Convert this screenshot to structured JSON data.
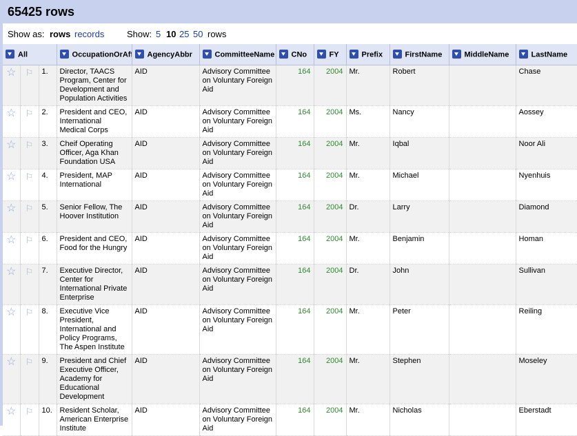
{
  "header": {
    "title": "65425 rows"
  },
  "controls": {
    "show_as_label": "Show as:",
    "view_rows": "rows",
    "view_records": "records",
    "show_label": "Show:",
    "page_sizes": [
      "5",
      "10",
      "25",
      "50"
    ],
    "rows_suffix": "rows"
  },
  "columns": [
    "All",
    "OccupationOrAffiliation",
    "AgencyAbbr",
    "CommitteeName",
    "CNo",
    "FY",
    "Prefix",
    "FirstName",
    "MiddleName",
    "LastName"
  ],
  "icons": {
    "star": "star-icon",
    "flag": "flag-icon",
    "dropdown": "dropdown-arrow-icon"
  },
  "colors": {
    "header_bg": "#c8d2ee",
    "link": "#1c3fa8",
    "number": "#2e8b2e",
    "dropdown": "#2f4fae"
  },
  "rows": [
    {
      "index": "1.",
      "occupation": "Director, TAACS Program, Center for Development and Population Activities",
      "agency": "AID",
      "committee": "Advisory Committee on Voluntary Foreign Aid",
      "cno": "164",
      "fy": "2004",
      "prefix": "Mr.",
      "first": "Robert",
      "middle": "",
      "last": "Chase"
    },
    {
      "index": "2.",
      "occupation": "President and CEO, International Medical Corps",
      "agency": "AID",
      "committee": "Advisory Committee on Voluntary Foreign Aid",
      "cno": "164",
      "fy": "2004",
      "prefix": "Ms.",
      "first": "Nancy",
      "middle": "",
      "last": "Aossey"
    },
    {
      "index": "3.",
      "occupation": "Cheif Operating Officer, Aga Khan Foundation USA",
      "agency": "AID",
      "committee": "Advisory Committee on Voluntary Foreign Aid",
      "cno": "164",
      "fy": "2004",
      "prefix": "Mr.",
      "first": "Iqbal",
      "middle": "",
      "last": "Noor Ali"
    },
    {
      "index": "4.",
      "occupation": "President, MAP International",
      "agency": "AID",
      "committee": "Advisory Committee on Voluntary Foreign Aid",
      "cno": "164",
      "fy": "2004",
      "prefix": "Mr.",
      "first": "Michael",
      "middle": "",
      "last": "Nyenhuis"
    },
    {
      "index": "5.",
      "occupation": "Senior Fellow, The Hoover Institution",
      "agency": "AID",
      "committee": "Advisory Committee on Voluntary Foreign Aid",
      "cno": "164",
      "fy": "2004",
      "prefix": "Dr.",
      "first": "Larry",
      "middle": "",
      "last": "Diamond"
    },
    {
      "index": "6.",
      "occupation": "President and CEO, Food for the Hungry",
      "agency": "AID",
      "committee": "Advisory Committee on Voluntary Foreign Aid",
      "cno": "164",
      "fy": "2004",
      "prefix": "Mr.",
      "first": "Benjamin",
      "middle": "",
      "last": "Homan"
    },
    {
      "index": "7.",
      "occupation": "Executive Director, Center for International Private Enterprise",
      "agency": "AID",
      "committee": "Advisory Committee on Voluntary Foreign Aid",
      "cno": "164",
      "fy": "2004",
      "prefix": "Dr.",
      "first": "John",
      "middle": "",
      "last": "Sullivan"
    },
    {
      "index": "8.",
      "occupation": "Executive Vice President, International and Policy Programs, The Aspen Institute",
      "agency": "AID",
      "committee": "Advisory Committee on Voluntary Foreign Aid",
      "cno": "164",
      "fy": "2004",
      "prefix": "Mr.",
      "first": "Peter",
      "middle": "",
      "last": "Reiling"
    },
    {
      "index": "9.",
      "occupation": "President and Chief Executive Officer, Academy for Educational Development",
      "agency": "AID",
      "committee": "Advisory Committee on Voluntary Foreign Aid",
      "cno": "164",
      "fy": "2004",
      "prefix": "Mr.",
      "first": "Stephen",
      "middle": "",
      "last": "Moseley"
    },
    {
      "index": "10.",
      "occupation": "Resident Scholar, American Enterprise Institute",
      "agency": "AID",
      "committee": "Advisory Committee on Voluntary Foreign Aid",
      "cno": "164",
      "fy": "2004",
      "prefix": "Mr.",
      "first": "Nicholas",
      "middle": "",
      "last": "Eberstadt"
    }
  ]
}
